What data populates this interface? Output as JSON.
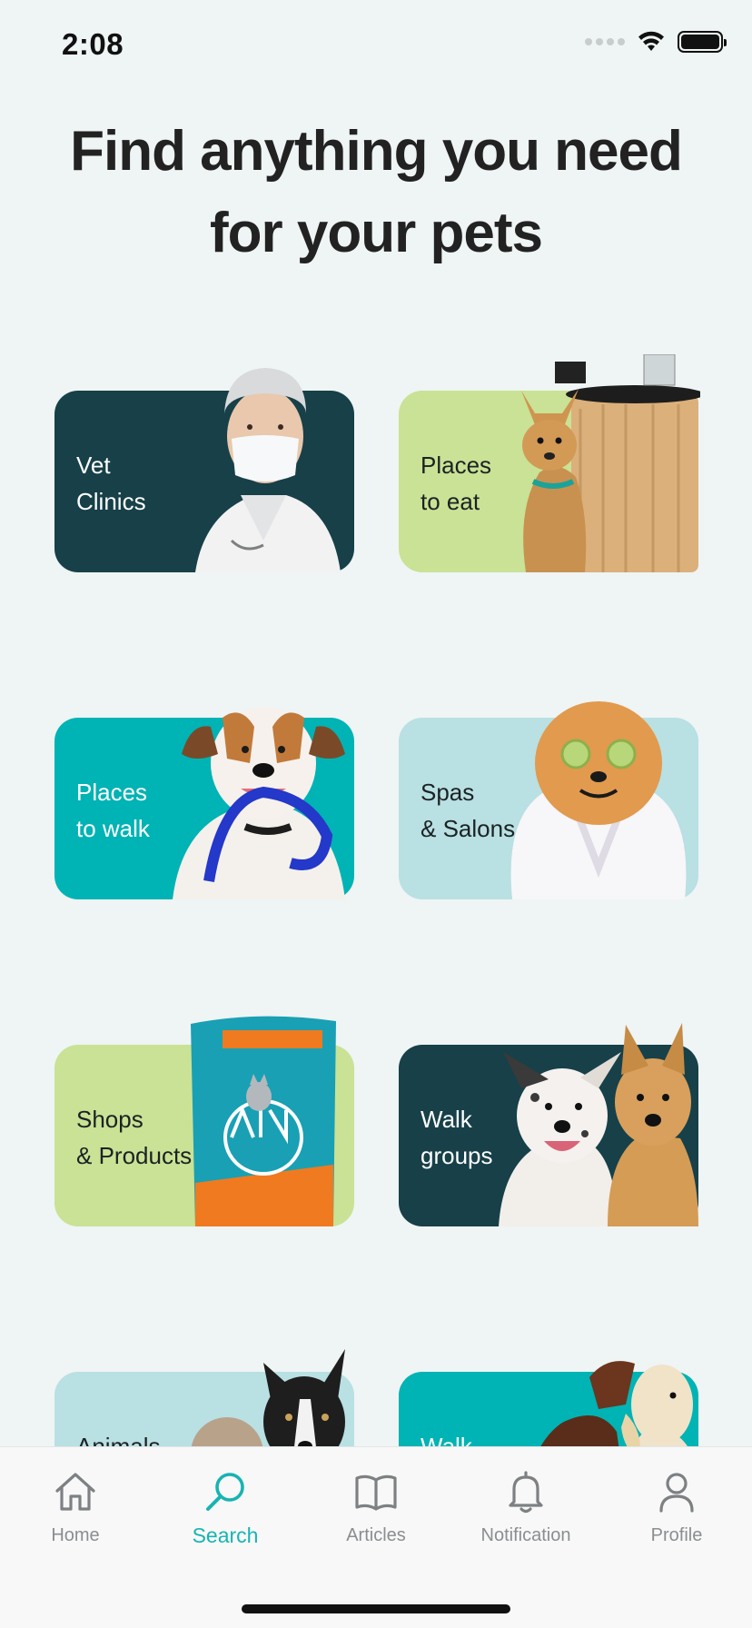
{
  "status_bar": {
    "time": "2:08"
  },
  "page": {
    "title": "Find anything you need for your pets"
  },
  "categories": [
    {
      "label": "Vet\nClinics",
      "theme": "dark",
      "art": "vet-person-image"
    },
    {
      "label": "Places\nto eat",
      "theme": "lime",
      "art": "chihuahua-image"
    },
    {
      "label": "Places\nto walk",
      "theme": "teal",
      "art": "dog-with-leash-image"
    },
    {
      "label": "Spas\n& Salons",
      "theme": "light",
      "art": "pomeranian-spa-image"
    },
    {
      "label": "Shops\n& Products",
      "theme": "lime",
      "art": "pet-food-bag-image"
    },
    {
      "label": "Walk\ngroups",
      "theme": "dark",
      "art": "two-dogs-image"
    },
    {
      "label": "Animals",
      "theme": "light",
      "art": "border-collie-image"
    },
    {
      "label": "Walk",
      "theme": "teal",
      "art": "two-dogs-kissing-image"
    }
  ],
  "nav": {
    "items": [
      {
        "label": "Home",
        "icon": "home-icon"
      },
      {
        "label": "Search",
        "icon": "search-icon",
        "active": true
      },
      {
        "label": "Articles",
        "icon": "book-icon"
      },
      {
        "label": "Notification",
        "icon": "bell-icon"
      },
      {
        "label": "Profile",
        "icon": "user-icon"
      }
    ]
  },
  "colors": {
    "background": "#eff4f4",
    "dark": "#174049",
    "lime": "#c9e295",
    "teal": "#00b3b4",
    "light": "#b9e0e2",
    "accent": "#19b3b3"
  }
}
